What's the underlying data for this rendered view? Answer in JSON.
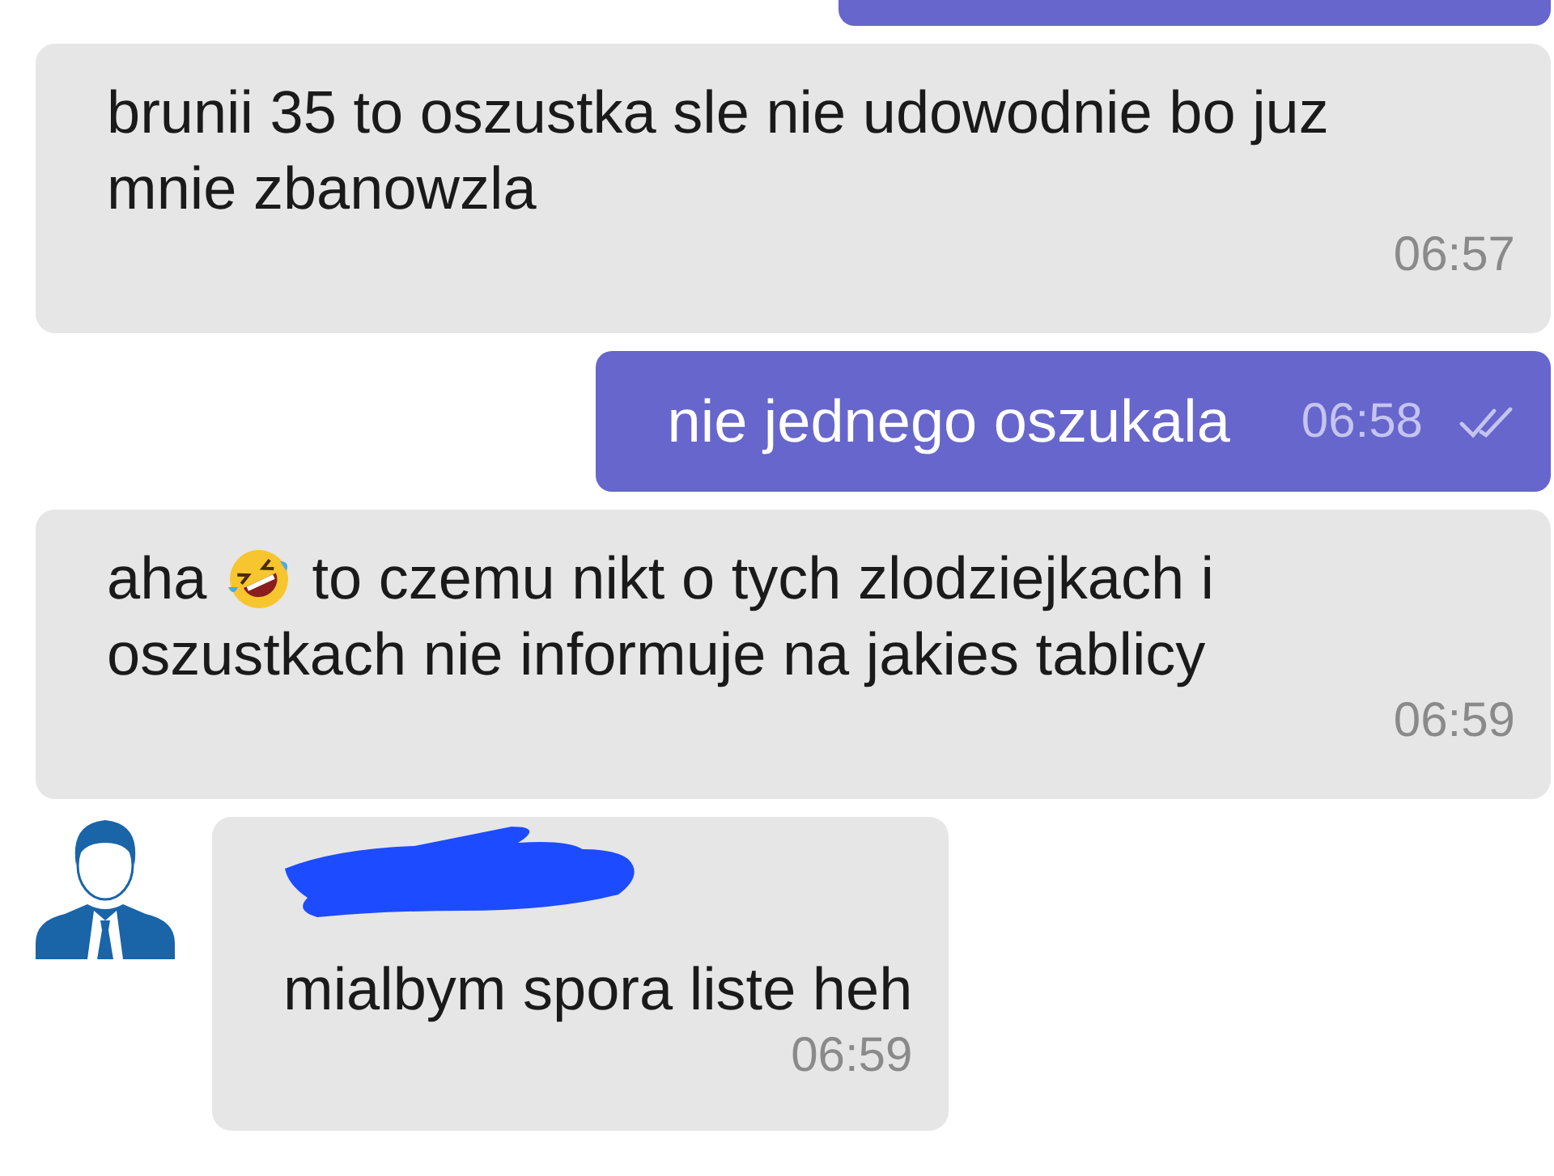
{
  "messages": [
    {
      "kind": "outgoing_cut"
    },
    {
      "kind": "incoming",
      "text": "brunii 35 to oszustka sle nie udowodnie bo juz mnie zbanowzla",
      "time": "06:57"
    },
    {
      "kind": "outgoing",
      "text": "nie jednego oszukala",
      "time": "06:58",
      "read": true
    },
    {
      "kind": "incoming_emoji",
      "text_before": "aha",
      "text_after": "to czemu nikt o tych zlodziejkach i",
      "text_line2": "oszustkach nie informuje na jakies tablicy",
      "time": "06:59"
    },
    {
      "kind": "incoming_avatar",
      "text": "mialbym spora liste heh",
      "time": "06:59",
      "redacted_name": true
    }
  ]
}
